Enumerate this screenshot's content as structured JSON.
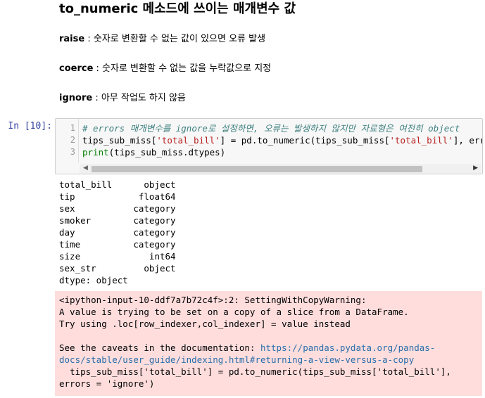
{
  "markdown": {
    "heading": "to_numeric 메소드에 쓰이는 매개변수 값",
    "items": [
      {
        "key": "raise",
        "sep": " : ",
        "desc": "숫자로 변환할 수 없는 값이 있으면 오류 발생"
      },
      {
        "key": "coerce",
        "sep": " : ",
        "desc": "숫자로 변환할 수 없는 값을 누락값으로 지정"
      },
      {
        "key": "ignore",
        "sep": " : ",
        "desc": "아무 작업도 하지 않음"
      }
    ]
  },
  "cell": {
    "prompt": "In [10]:",
    "line_numbers": [
      "1",
      "2",
      "3"
    ],
    "line1_comment": "# errors 매개변수를 ignore로 설정하면, 오류는 발생하지 않지만 자료형은 여전히 object",
    "line2_a": "tips_sub_miss[",
    "line2_str1": "'total_bill'",
    "line2_b": "] = pd.to_numeric(tips_sub_miss[",
    "line2_str2": "'total_bill'",
    "line2_c": "], errors = ",
    "line3_builtin": "print",
    "line3_rest": "(tips_sub_miss.dtypes)"
  },
  "output": {
    "dtypes": "total_bill      object\ntip            float64\nsex           category\nsmoker        category\nday           category\ntime          category\nsize             int64\nsex_str         object\ndtype: object"
  },
  "warning": {
    "line1": "<ipython-input-10-ddf7a7b72c4f>:2: SettingWithCopyWarning:",
    "line2": "A value is trying to be set on a copy of a slice from a DataFrame.",
    "line3": "Try using .loc[row_indexer,col_indexer] = value instead",
    "line4": "",
    "line5_prefix": "See the caveats in the documentation: ",
    "link": "https://pandas.pydata.org/pandas-docs/stable/user_guide/indexing.html#returning-a-view-versus-a-copy",
    "line6": "  tips_sub_miss['total_bill'] = pd.to_numeric(tips_sub_miss['total_bill'], errors = 'ignore')"
  }
}
